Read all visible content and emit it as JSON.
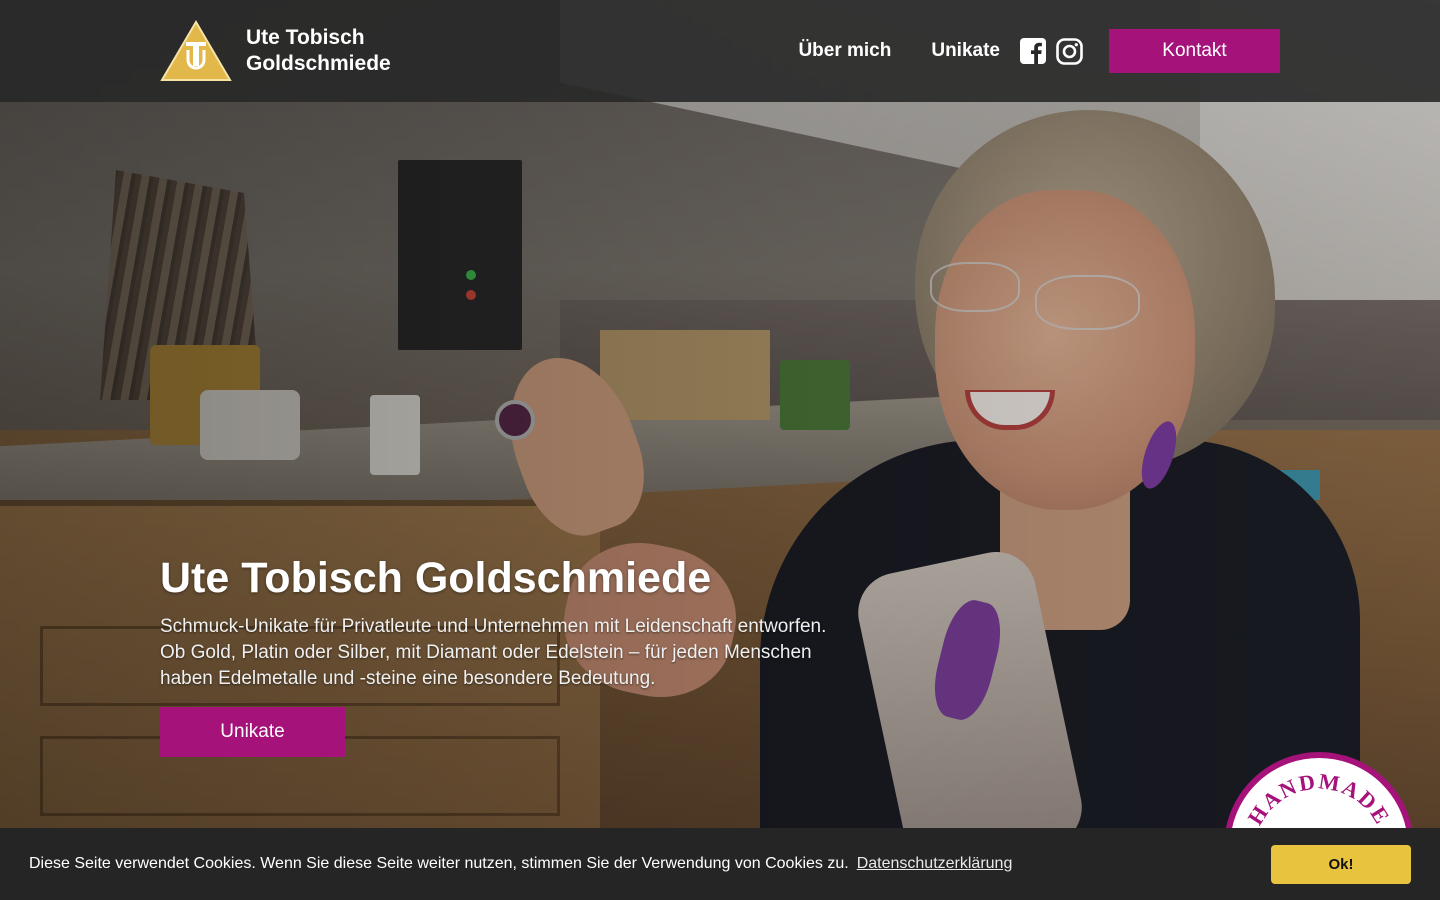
{
  "header": {
    "brand_line1": "Ute Tobisch",
    "brand_line2": "Goldschmiede",
    "logo_letters": "UT",
    "nav": {
      "about": "Über mich",
      "unikate": "Unikate",
      "contact": "Kontakt"
    },
    "social_icons": [
      "facebook-icon",
      "instagram-icon"
    ]
  },
  "hero": {
    "title": "Ute Tobisch Goldschmiede",
    "subtitle": "Schmuck-Unikate für Privatleute und Unternehmen mit Leidenschaft entworfen. Ob Gold, Platin oder Silber, mit Diamant oder Edelstein – für jeden Menschen haben Edelmetalle und -steine eine besondere Bedeutung.",
    "cta": "Unikate"
  },
  "badge": {
    "text": "HANDMADE"
  },
  "cookie": {
    "message": "Diese Seite verwendet Cookies. Wenn Sie diese Seite weiter nutzen, stimmen Sie der Verwendung von Cookies zu.",
    "link": "Datenschutzerklärung",
    "accept": "Ok!"
  },
  "colors": {
    "accent": "#a5127a",
    "header_bg": "#282828",
    "cookie_bg": "#252525",
    "cookie_button": "#e8c33e",
    "logo_gold": "#e2b84a"
  }
}
